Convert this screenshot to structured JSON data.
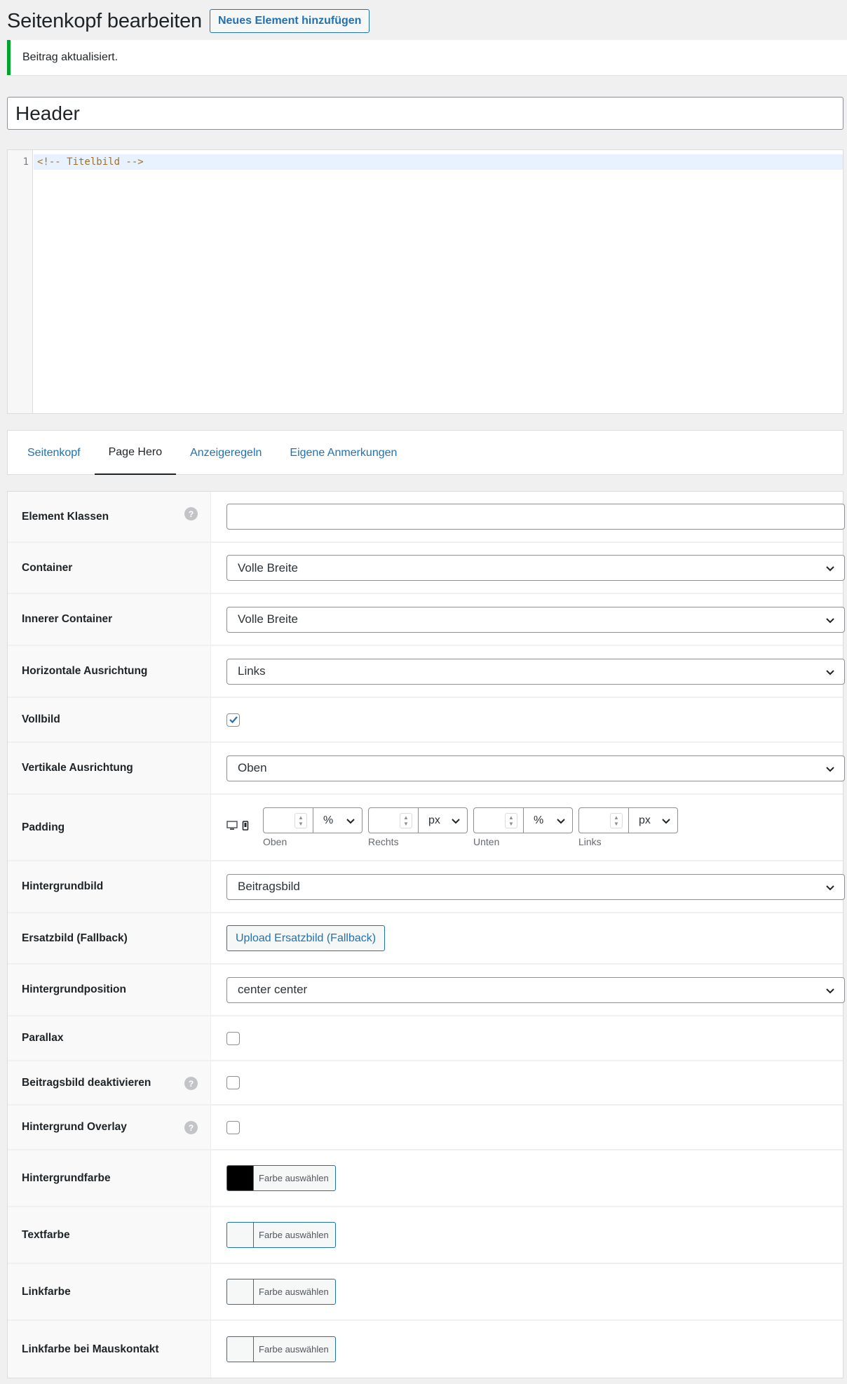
{
  "header": {
    "title": "Seitenkopf bearbeiten",
    "add_new_label": "Neues Element hinzufügen"
  },
  "notice": {
    "text": "Beitrag aktualisiert."
  },
  "post_title": {
    "value": "Header"
  },
  "code_editor": {
    "line_number": "1",
    "line_text": "<!-- Titelbild -->"
  },
  "tabs": [
    {
      "label": "Seitenkopf",
      "active": false
    },
    {
      "label": "Page Hero",
      "active": true
    },
    {
      "label": "Anzeigeregeln",
      "active": false
    },
    {
      "label": "Eigene Anmerkungen",
      "active": false
    }
  ],
  "settings": {
    "element_classes": {
      "label": "Element Klassen",
      "value": ""
    },
    "container": {
      "label": "Container",
      "value": "Volle Breite"
    },
    "inner_container": {
      "label": "Innerer Container",
      "value": "Volle Breite"
    },
    "horizontal_alignment": {
      "label": "Horizontale Ausrichtung",
      "value": "Links"
    },
    "fullscreen": {
      "label": "Vollbild",
      "checked": true
    },
    "vertical_alignment": {
      "label": "Vertikale Ausrichtung",
      "value": "Oben"
    },
    "padding": {
      "label": "Padding",
      "top": {
        "caption": "Oben",
        "value": "",
        "unit": "%"
      },
      "right": {
        "caption": "Rechts",
        "value": "",
        "unit": "px"
      },
      "bottom": {
        "caption": "Unten",
        "value": "",
        "unit": "%"
      },
      "left": {
        "caption": "Links",
        "value": "",
        "unit": "px"
      }
    },
    "background_image": {
      "label": "Hintergrundbild",
      "value": "Beitragsbild"
    },
    "fallback_image": {
      "label": "Ersatzbild (Fallback)",
      "button": "Upload Ersatzbild (Fallback)"
    },
    "background_position": {
      "label": "Hintergrundposition",
      "value": "center center"
    },
    "parallax": {
      "label": "Parallax",
      "checked": false
    },
    "disable_featured_image": {
      "label": "Beitragsbild deaktivieren",
      "checked": false
    },
    "background_overlay": {
      "label": "Hintergrund Overlay",
      "checked": false
    },
    "background_color": {
      "label": "Hintergrundfarbe",
      "button": "Farbe auswählen",
      "color": "#000000"
    },
    "text_color": {
      "label": "Textfarbe",
      "button": "Farbe auswählen",
      "color": ""
    },
    "link_color": {
      "label": "Linkfarbe",
      "button": "Farbe auswählen",
      "color": ""
    },
    "link_hover_color": {
      "label": "Linkfarbe bei Mauskontakt",
      "button": "Farbe auswählen",
      "color": ""
    }
  },
  "help_icon_glyph": "?",
  "colors": {
    "accent": "#2271b1",
    "success": "#00a32a"
  }
}
